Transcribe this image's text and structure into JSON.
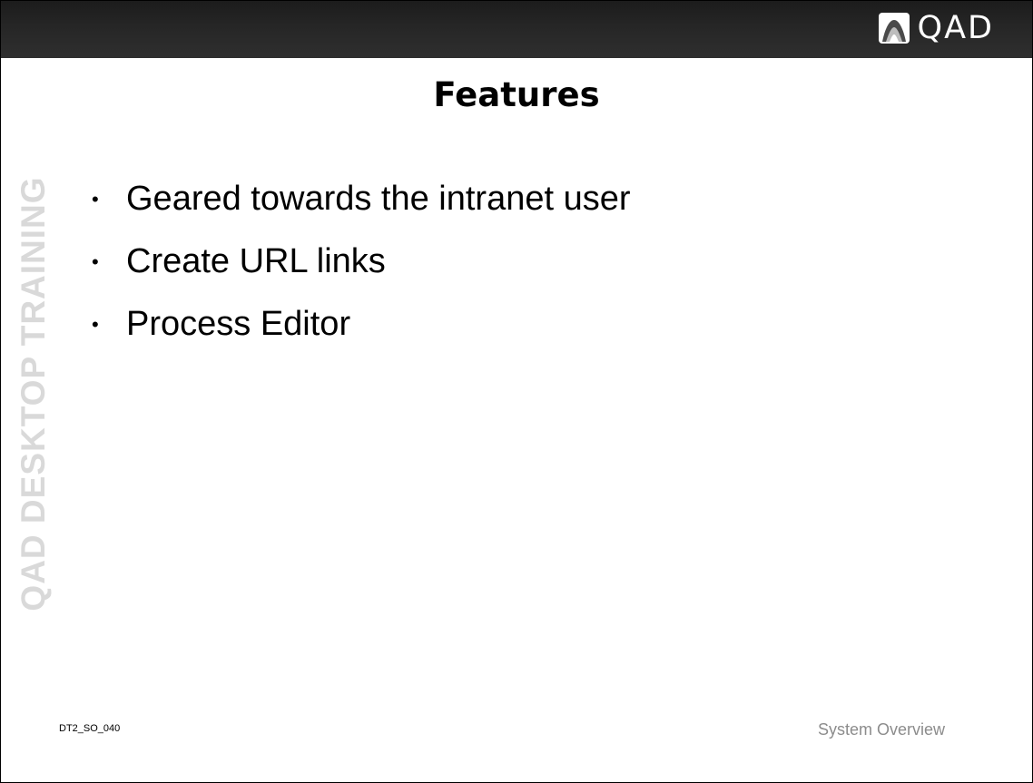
{
  "header": {
    "logo_text": "QAD",
    "logo_icon": "qad-mountain-logo-icon"
  },
  "slide": {
    "title": "Features",
    "watermark": "QAD DESKTOP TRAINING",
    "bullets": [
      {
        "text": "Geared towards the intranet user"
      },
      {
        "text": "Create URL links"
      },
      {
        "text": "Process Editor"
      }
    ]
  },
  "footer": {
    "slide_code": "DT2_SO_040",
    "section_title": "System Overview"
  },
  "colors": {
    "header_bar": "#262626",
    "watermark": "#d9d9d9",
    "footer_text": "#8c8c8c"
  }
}
